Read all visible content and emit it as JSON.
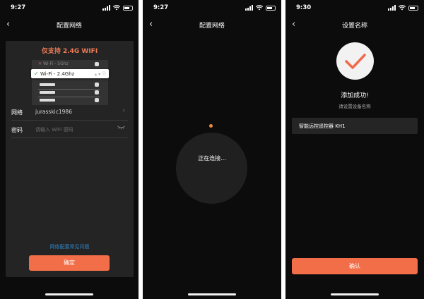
{
  "phones": [
    {
      "status_time": "9:27",
      "title": "配置网络",
      "support_text": "仅支持 2.4G WIFI",
      "wifi_illustration": {
        "row1": "Wi-Fi - 5Ghz",
        "selected": "Wi-Fi - 2.4Ghz"
      },
      "network_label": "网络",
      "network_value": "jurasskic1986",
      "password_label": "密码",
      "password_placeholder": "请输入 WiFi 密码",
      "faq_link": "网络配置常见问题",
      "confirm_button": "确定"
    },
    {
      "status_time": "9:27",
      "title": "配置网络",
      "connecting_text": "正在连接..."
    },
    {
      "status_time": "9:30",
      "title": "设置名称",
      "success_title": "添加成功!",
      "hint": "请设置设备名称",
      "device_name": "智能远控遥控器 KH1",
      "confirm_button": "确认"
    }
  ],
  "colors": {
    "accent": "#f26e48",
    "support_text": "#ec7b57",
    "link": "#2f84c6",
    "background": "#0c0c0c",
    "card": "#242424"
  },
  "icons": {
    "back": "chevron-left-icon",
    "network_arrow": "chevron-right-icon",
    "password_eye": "eye-closed-icon",
    "success": "checkmark-icon"
  }
}
